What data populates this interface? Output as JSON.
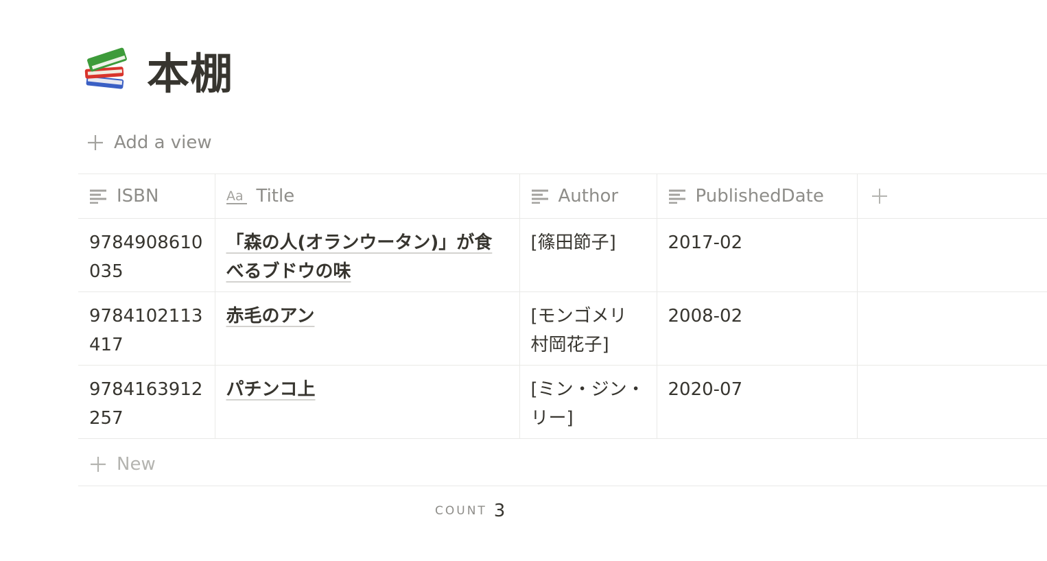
{
  "page": {
    "icon": "books-icon",
    "title": "本棚"
  },
  "toolbar": {
    "add_view_label": "Add a view"
  },
  "table": {
    "columns": [
      {
        "icon": "text-lines-icon",
        "label": "ISBN"
      },
      {
        "icon": "title-aa-icon",
        "label": "Title"
      },
      {
        "icon": "text-lines-icon",
        "label": "Author"
      },
      {
        "icon": "text-lines-icon",
        "label": "PublishedDate"
      }
    ],
    "rows": [
      {
        "isbn": "9784908610035",
        "title": "「森の人(オランウータン)」が食べるブドウの味",
        "author": "[篠田節子]",
        "published": "2017-02"
      },
      {
        "isbn": "9784102113417",
        "title": "赤毛のアン",
        "author": "[モンゴメリ 村岡花子]",
        "published": "2008-02"
      },
      {
        "isbn": "9784163912257",
        "title": "パチンコ上",
        "author": "[ミン・ジン・リー]",
        "published": "2020-07"
      }
    ],
    "new_label": "New"
  },
  "footer": {
    "count_label": "COUNT",
    "count_value": "3"
  },
  "colors": {
    "text": "#37352f",
    "muted": "#8e8d89",
    "border": "#e9e9e7"
  }
}
